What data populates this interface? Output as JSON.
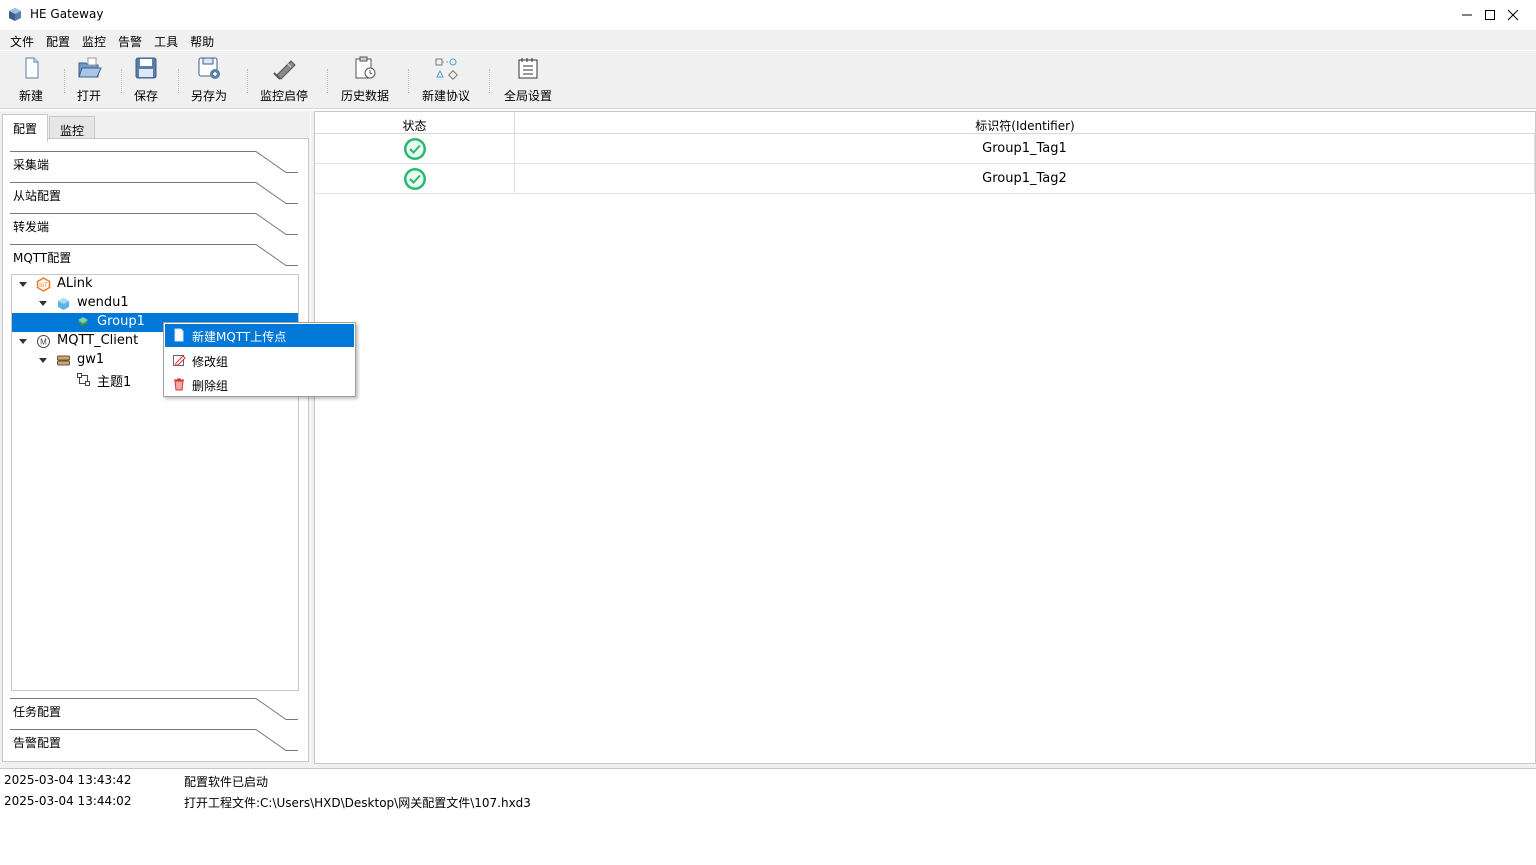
{
  "window": {
    "title": "HE Gateway"
  },
  "menu": [
    "文件",
    "配置",
    "监控",
    "告警",
    "工具",
    "帮助"
  ],
  "toolbar": [
    {
      "label": "新建",
      "icon": "new-file-icon"
    },
    {
      "label": "打开",
      "icon": "open-folder-icon"
    },
    {
      "label": "保存",
      "icon": "save-icon"
    },
    {
      "label": "另存为",
      "icon": "save-as-icon"
    },
    {
      "label": "监控启停",
      "icon": "monitor-toggle-icon"
    },
    {
      "label": "历史数据",
      "icon": "history-data-icon"
    },
    {
      "label": "新建协议",
      "icon": "new-protocol-icon"
    },
    {
      "label": "全局设置",
      "icon": "global-settings-icon"
    }
  ],
  "tabs": [
    "配置",
    "监控"
  ],
  "sections": {
    "top": [
      "采集端",
      "从站配置",
      "转发端",
      "MQTT配置"
    ],
    "bottom": [
      "任务配置",
      "告警配置"
    ]
  },
  "tree": [
    {
      "label": "ALink",
      "level": 0,
      "expanded": true,
      "icon": "alink-icon"
    },
    {
      "label": "wendu1",
      "level": 1,
      "expanded": true,
      "icon": "device-cube-icon"
    },
    {
      "label": "Group1",
      "level": 2,
      "selected": true,
      "icon": "group-icon"
    },
    {
      "label": "MQTT_Client",
      "level": 0,
      "expanded": true,
      "icon": "mqtt-icon"
    },
    {
      "label": "gw1",
      "level": 1,
      "expanded": true,
      "icon": "gateway-icon"
    },
    {
      "label": "主题1",
      "level": 2,
      "icon": "topic-icon"
    }
  ],
  "table": {
    "headers": [
      "状态",
      "标识符(Identifier)"
    ],
    "rows": [
      {
        "status": "ok",
        "identifier": "Group1_Tag1"
      },
      {
        "status": "ok",
        "identifier": "Group1_Tag2"
      }
    ]
  },
  "context_menu": [
    "新建MQTT上传点",
    "修改组",
    "删除组"
  ],
  "log": [
    {
      "time": "2025-03-04 13:43:42",
      "message": "配置软件已启动"
    },
    {
      "time": "2025-03-04 13:44:02",
      "message": "打开工程文件:C:\\Users\\HXD\\Desktop\\网关配置文件\\107.hxd3"
    }
  ],
  "colors": {
    "accent": "#0078d7",
    "status_ok": "#2bb673",
    "alink": "#f07b22"
  }
}
